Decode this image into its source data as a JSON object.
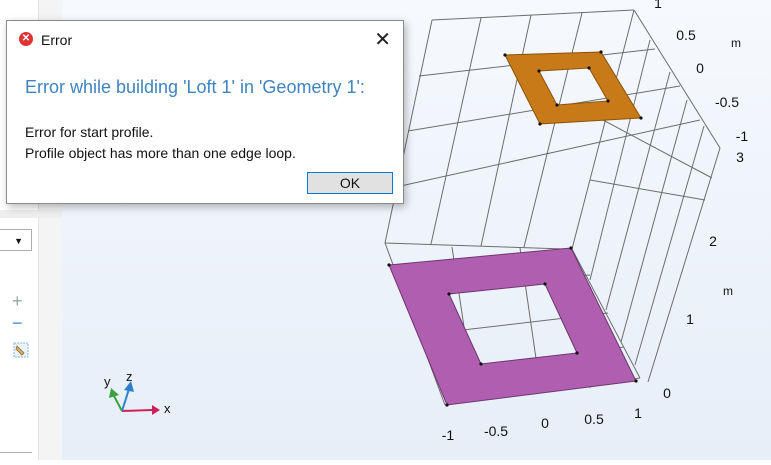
{
  "dialog": {
    "title": "Error",
    "heading": "Error while building 'Loft 1' in 'Geometry 1':",
    "line1": "Error for start profile.",
    "line2": "Profile object has more than one edge loop.",
    "ok_label": "OK",
    "icon": "error-icon",
    "close_icon": "close-icon"
  },
  "left_panel": {
    "dropdown_icon": "chevron-down-icon",
    "add_icon": "plus-icon",
    "remove_icon": "minus-icon",
    "clear_icon": "clear-selection-icon"
  },
  "axes": {
    "triad_y": "y",
    "triad_z": "z",
    "triad_x": "x",
    "x_ticks": [
      "-1",
      "-0.5",
      "0",
      "0.5",
      "1"
    ],
    "y_ticks": [
      "0.5",
      "0",
      "-0.5",
      "-1"
    ],
    "y_unit": "m",
    "z_ticks": [
      "0",
      "1",
      "2",
      "3"
    ],
    "z_unit": "m",
    "top_tick": "1"
  },
  "colors": {
    "accent": "#3f84c0",
    "start_profile": "#b05fb0",
    "top_profile": "#c77a17",
    "triad_x": "#d0205a",
    "triad_y": "#3aa040",
    "triad_z": "#2f7fd0"
  }
}
